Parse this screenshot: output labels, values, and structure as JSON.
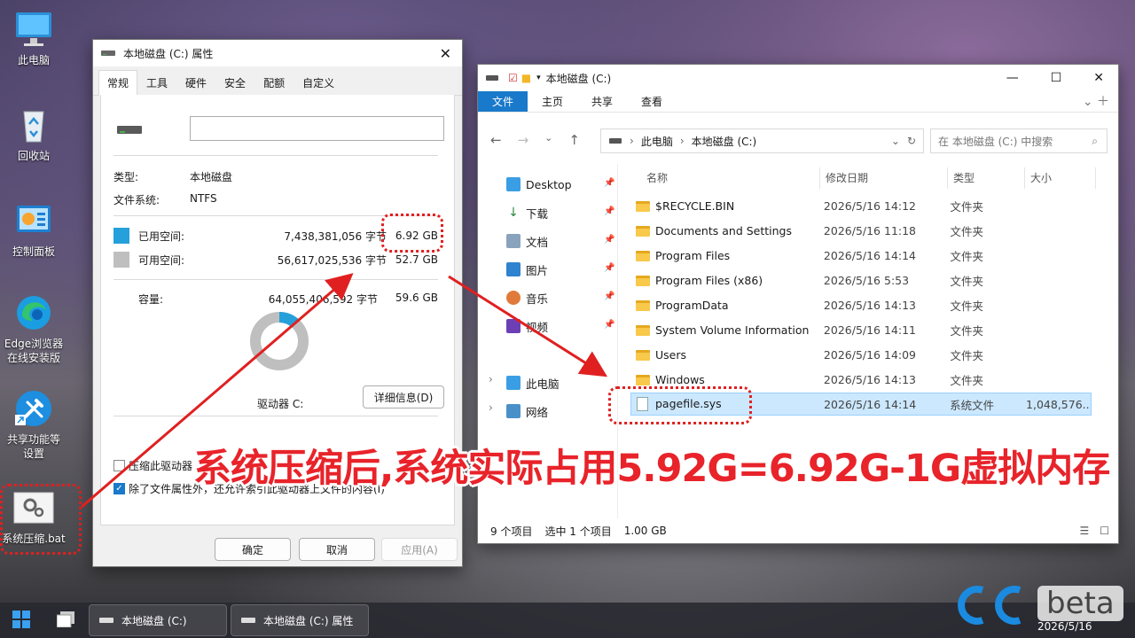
{
  "desktop": {
    "icons": [
      {
        "label": "此电脑"
      },
      {
        "label": "回收站"
      },
      {
        "label": "控制面板"
      },
      {
        "label": "Edge浏览器在线安装版"
      },
      {
        "label": "共享功能等设置"
      },
      {
        "label": "系统压缩.bat"
      }
    ]
  },
  "props": {
    "title": "本地磁盘 (C:) 属性",
    "tabs": [
      "常规",
      "工具",
      "硬件",
      "安全",
      "配额",
      "自定义"
    ],
    "name_value": "",
    "type_label": "类型:",
    "type_value": "本地磁盘",
    "fs_label": "文件系统:",
    "fs_value": "NTFS",
    "used_label": "已用空间:",
    "used_bytes": "7,438,381,056 字节",
    "used_gb": "6.92 GB",
    "free_label": "可用空间:",
    "free_bytes": "56,617,025,536 字节",
    "free_gb": "52.7 GB",
    "cap_label": "容量:",
    "cap_bytes": "64,055,406,592 字节",
    "cap_gb": "59.6 GB",
    "drive_label": "驱动器 C:",
    "details_button": "详细信息(D)",
    "compress_label": "压缩此驱动器",
    "index_label": "除了文件属性外，还允许索引此驱动器上文件的内容(I)",
    "index_checked": true,
    "ok": "确定",
    "cancel": "取消",
    "apply": "应用(A)",
    "used_fraction": 0.116
  },
  "explorer": {
    "title": "本地磁盘 (C:)",
    "ribbon_tabs": [
      "文件",
      "主页",
      "共享",
      "查看"
    ],
    "breadcrumb": [
      "此电脑",
      "本地磁盘 (C:)"
    ],
    "search_placeholder": "在 本地磁盘 (C:) 中搜索",
    "nav": [
      "Desktop",
      "下载",
      "文档",
      "图片",
      "音乐",
      "视频",
      "此电脑",
      "网络"
    ],
    "columns": [
      "名称",
      "修改日期",
      "类型",
      "大小"
    ],
    "files": [
      {
        "name": "$RECYCLE.BIN",
        "date": "2026/5/16 14:12",
        "type": "文件夹",
        "size": ""
      },
      {
        "name": "Documents and Settings",
        "date": "2026/5/16 11:18",
        "type": "文件夹",
        "size": ""
      },
      {
        "name": "Program Files",
        "date": "2026/5/16 14:14",
        "type": "文件夹",
        "size": ""
      },
      {
        "name": "Program Files (x86)",
        "date": "2026/5/16 5:53",
        "type": "文件夹",
        "size": ""
      },
      {
        "name": "ProgramData",
        "date": "2026/5/16 14:13",
        "type": "文件夹",
        "size": ""
      },
      {
        "name": "System Volume Information",
        "date": "2026/5/16 14:11",
        "type": "文件夹",
        "size": ""
      },
      {
        "name": "Users",
        "date": "2026/5/16 14:09",
        "type": "文件夹",
        "size": ""
      },
      {
        "name": "Windows",
        "date": "2026/5/16 14:13",
        "type": "文件夹",
        "size": ""
      },
      {
        "name": "pagefile.sys",
        "date": "2026/5/16 14:14",
        "type": "系统文件",
        "size": "1,048,576..."
      }
    ],
    "status_items": "9 个项目",
    "status_selected": "选中 1 个项目",
    "status_size": "1.00 GB"
  },
  "taskbar": {
    "buttons": [
      "本地磁盘 (C:)",
      "本地磁盘 (C:) 属性"
    ],
    "clock_date": "2026/5/16"
  },
  "annotation": {
    "text": "系统压缩后,系统实际占用5.92G=6.92G-1G虚拟内存",
    "color": "#e8232a"
  },
  "watermark": {
    "brand_text": "beta"
  },
  "colors": {
    "accent": "#1979ca",
    "used_swatch": "#26a0da",
    "free_swatch": "#bfbfbf"
  }
}
